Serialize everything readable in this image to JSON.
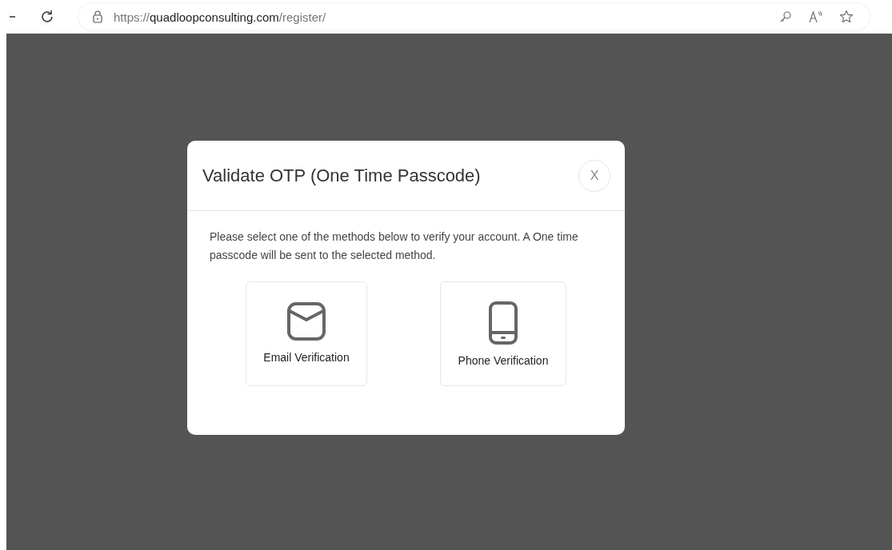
{
  "browser": {
    "url": {
      "scheme": "https://",
      "host": "quadloopconsulting.com",
      "path": "/register/"
    }
  },
  "dialog": {
    "title": "Validate OTP (One Time Passcode)",
    "close": "X",
    "message": "Please select one of the methods below to verify your account. A One time passcode will be sent to the selected method.",
    "methods": [
      {
        "kind": "email",
        "label": "Email Verification"
      },
      {
        "kind": "phone",
        "label": "Phone Verification"
      }
    ]
  }
}
